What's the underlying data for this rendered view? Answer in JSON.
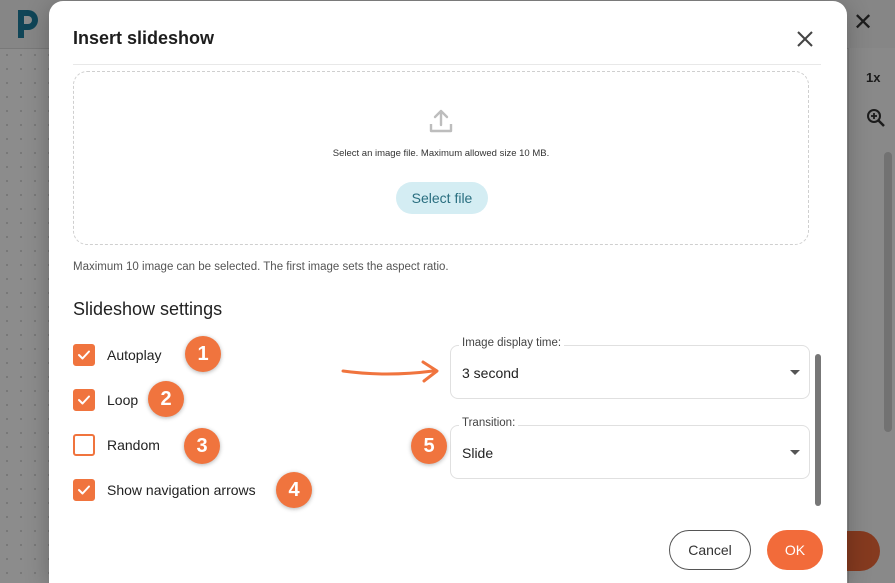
{
  "background": {
    "zoom_label": "1x"
  },
  "dialog": {
    "title": "Insert slideshow",
    "dropzone_text": "Select an image file. Maximum allowed size 10 MB.",
    "select_file_label": "Select file",
    "hint": "Maximum 10 image can be selected. The first image sets the aspect ratio.",
    "settings_title": "Slideshow settings",
    "options": [
      {
        "label": "Autoplay",
        "checked": true,
        "badge": "1"
      },
      {
        "label": "Loop",
        "checked": true,
        "badge": "2"
      },
      {
        "label": "Random",
        "checked": false,
        "badge": "3"
      },
      {
        "label": "Show navigation arrows",
        "checked": true,
        "badge": "4"
      }
    ],
    "display_time": {
      "label": "Image display time:",
      "value": "3 second"
    },
    "transition": {
      "label": "Transition:",
      "value": "Slide",
      "badge": "5"
    },
    "cancel_label": "Cancel",
    "ok_label": "OK"
  },
  "colors": {
    "accent": "#f0743e",
    "select_file_bg": "#d4edf3",
    "select_file_text": "#2a6f80"
  },
  "icons": {
    "close": "close-icon",
    "upload": "upload-icon",
    "checkmark": "checkmark-icon",
    "dropdown": "chevron-down-icon",
    "annotation_arrow": "arrow-right-icon"
  }
}
